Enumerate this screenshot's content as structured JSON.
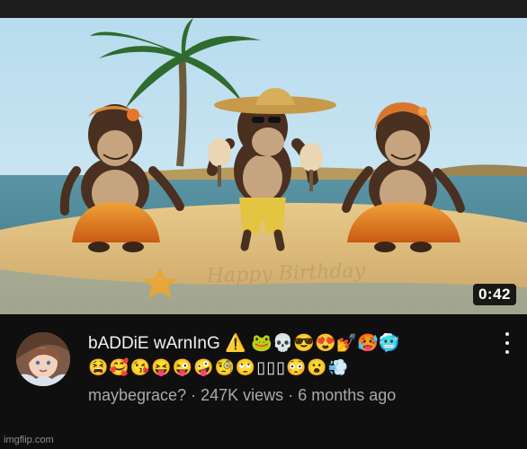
{
  "video": {
    "duration": "0:42",
    "sand_text": "Happy Birthday"
  },
  "details": {
    "title_line1": "bADDiE wArnInG ⚠️ 🐸💀😎😍💅🥵🥶",
    "title_line2": "😫🥰😘😝😜🤪🧐🙄▯▯▯😳😮💨",
    "channel": "maybegrace?",
    "separator": "·",
    "views": "247K views",
    "age": "6 months ago"
  },
  "icons": {
    "more": "more-vert-icon",
    "avatar": "avatar"
  },
  "watermark": "imgflip.com",
  "colors": {
    "background": "#0f0f0f",
    "title": "#f1f1f1",
    "meta": "#aaaaaa"
  }
}
